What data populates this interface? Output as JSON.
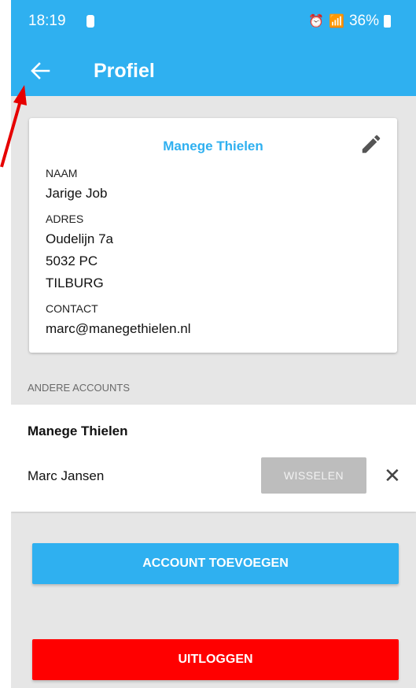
{
  "status_bar": {
    "time": "18:19",
    "battery": "36%"
  },
  "app_bar": {
    "title": "Profiel",
    "back_icon": "arrow-left-icon"
  },
  "profile_card": {
    "title": "Manege Thielen",
    "name_label": "NAAM",
    "name_value": "Jarige Job",
    "address_label": "ADRES",
    "address_line1": "Oudelijn 7a",
    "address_line2": "5032 PC",
    "address_line3": "TILBURG",
    "contact_label": "CONTACT",
    "contact_value": "marc@manegethielen.nl"
  },
  "accounts": {
    "section_label": "ANDERE ACCOUNTS",
    "group_name": "Manege Thielen",
    "user_name": "Marc Jansen",
    "switch_label": "WISSELEN"
  },
  "actions": {
    "add_account_label": "ACCOUNT TOEVOEGEN",
    "logout_label": "UITLOGGEN"
  },
  "colors": {
    "accent": "#2fb0f0",
    "danger": "#ff0000",
    "annotation": "#e60000"
  }
}
